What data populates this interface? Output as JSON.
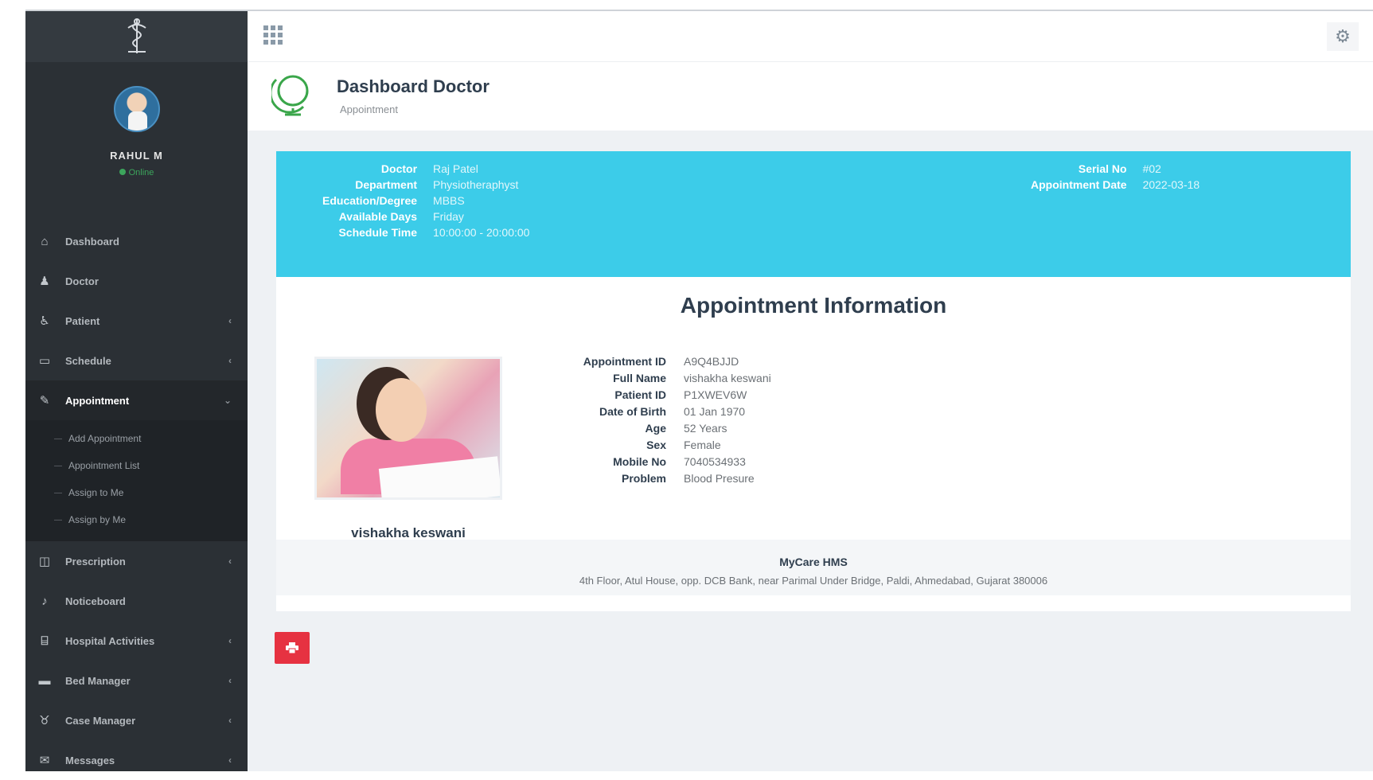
{
  "sidebar": {
    "user_name": "RAHUL M",
    "status": "Online",
    "items": [
      {
        "label": "Dashboard",
        "icon": "home-icon",
        "glyph": "⌂"
      },
      {
        "label": "Doctor",
        "icon": "user-md-icon",
        "glyph": "♟"
      },
      {
        "label": "Patient",
        "icon": "wheelchair-icon",
        "glyph": "♿"
      },
      {
        "label": "Schedule",
        "icon": "calendar-icon",
        "glyph": "▭"
      },
      {
        "label": "Appointment",
        "icon": "edit-icon",
        "glyph": "✎"
      },
      {
        "label": "Prescription",
        "icon": "book-icon",
        "glyph": "◫"
      },
      {
        "label": "Noticeboard",
        "icon": "bell-icon",
        "glyph": "♪"
      },
      {
        "label": "Hospital Activities",
        "icon": "hospital-icon",
        "glyph": "⌸"
      },
      {
        "label": "Bed Manager",
        "icon": "bed-icon",
        "glyph": "▬"
      },
      {
        "label": "Case Manager",
        "icon": "stethoscope-icon",
        "glyph": "♉"
      },
      {
        "label": "Messages",
        "icon": "chat-icon",
        "glyph": "✉"
      }
    ],
    "submenu": [
      "Add Appointment",
      "Appointment List",
      "Assign to Me",
      "Assign by Me"
    ]
  },
  "header": {
    "title": "Dashboard Doctor",
    "subtitle": "Appointment"
  },
  "banner": {
    "left": [
      {
        "key": "Doctor",
        "value": "Raj Patel"
      },
      {
        "key": "Department",
        "value": "Physiotheraphyst"
      },
      {
        "key": "Education/Degree",
        "value": "MBBS"
      },
      {
        "key": "Available Days",
        "value": "Friday"
      },
      {
        "key": "Schedule Time",
        "value": "10:00:00 - 20:00:00"
      }
    ],
    "right": [
      {
        "key": "Serial No",
        "value": "#02"
      },
      {
        "key": "Appointment Date",
        "value": "2022-03-18"
      }
    ]
  },
  "appointment": {
    "title": "Appointment Information",
    "patient_name": "vishakha keswani",
    "details": [
      {
        "key": "Appointment ID",
        "value": "A9Q4BJJD"
      },
      {
        "key": "Full Name",
        "value": "vishakha keswani"
      },
      {
        "key": "Patient ID",
        "value": "P1XWEV6W"
      },
      {
        "key": "Date of Birth",
        "value": "01 Jan 1970"
      },
      {
        "key": "Age",
        "value": "52 Years"
      },
      {
        "key": "Sex",
        "value": "Female"
      },
      {
        "key": "Mobile No",
        "value": "7040534933"
      },
      {
        "key": "Problem",
        "value": "Blood Presure"
      }
    ]
  },
  "footer": {
    "name": "MyCare HMS",
    "address": "4th Floor, Atul House, opp. DCB Bank, near Parimal Under Bridge, Paldi, Ahmedabad, Gujarat 380006"
  },
  "colors": {
    "sidebar": "#2b3035",
    "banner": "#3ccce9",
    "print_button": "#e63241",
    "content_bg": "#eef1f4"
  }
}
